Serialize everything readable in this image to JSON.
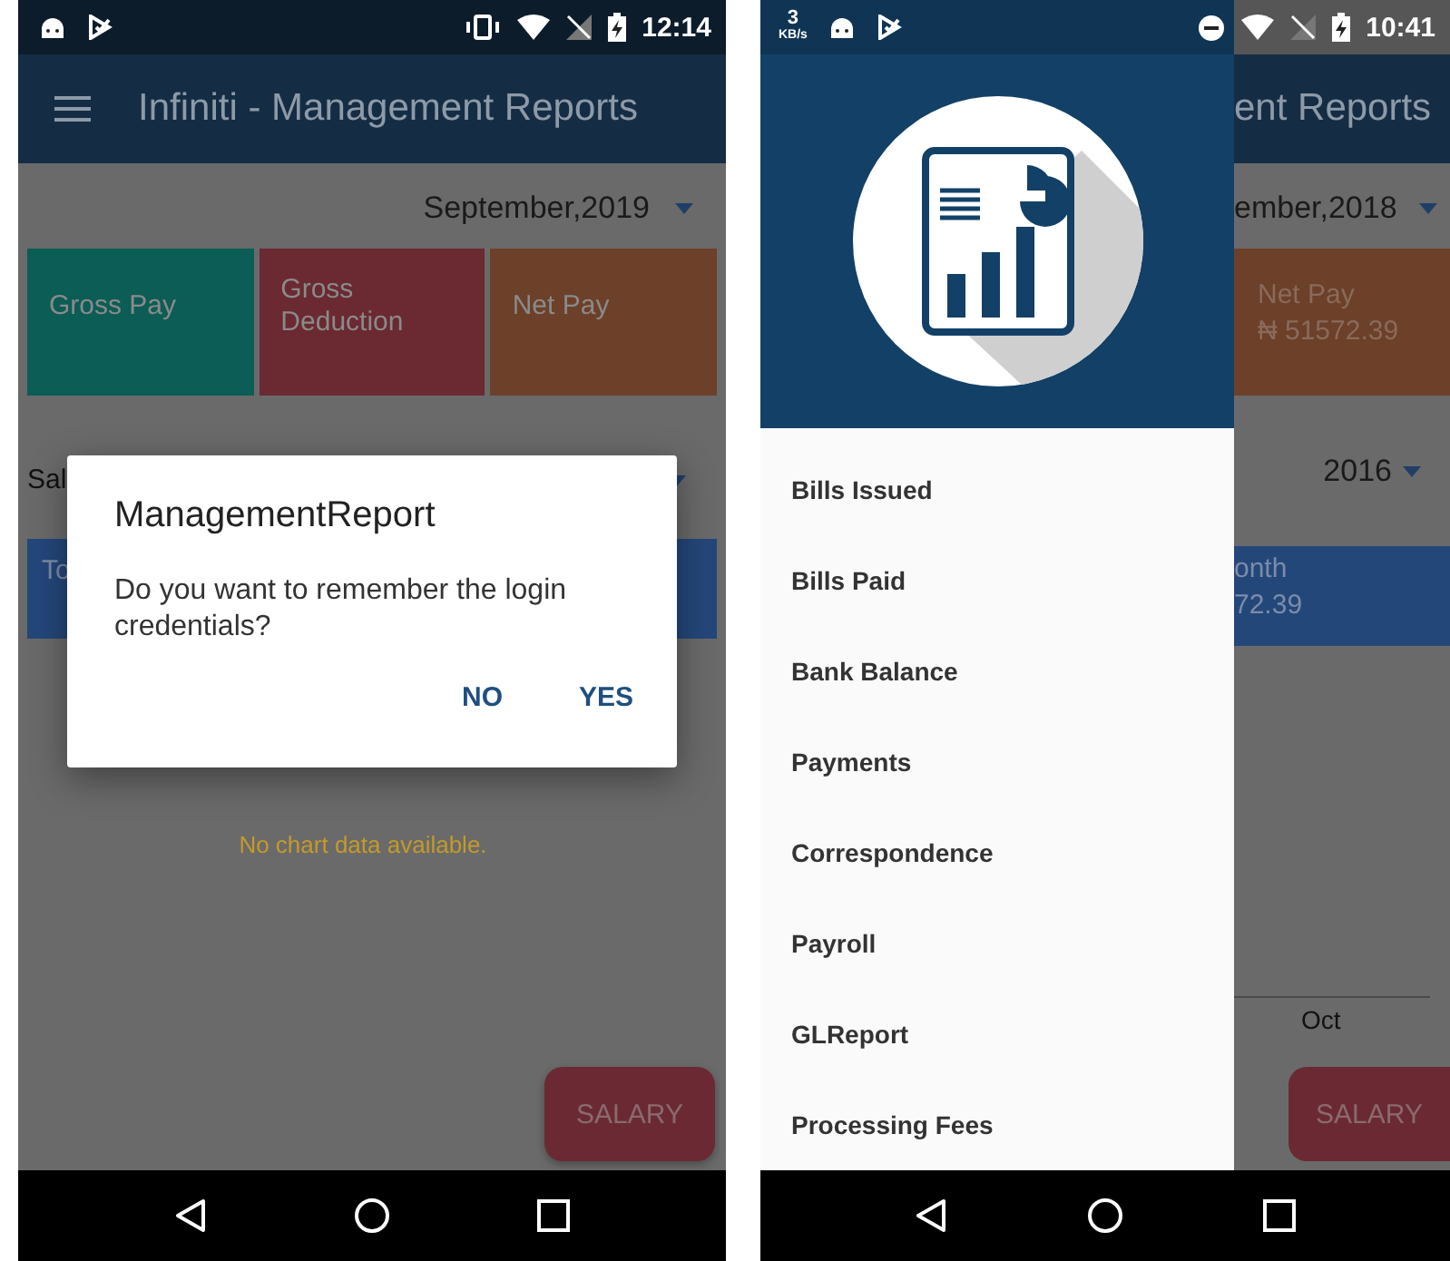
{
  "left_screen": {
    "status_bar": {
      "time": "12:14"
    },
    "app_bar": {
      "title": "Infiniti - Management Reports"
    },
    "period_dropdown": {
      "value": "September,2019"
    },
    "cards": [
      {
        "label": "Gross Pay",
        "color": "#0b5d55"
      },
      {
        "label": "Gross Deduction",
        "color": "#6b2932"
      },
      {
        "label": "Net Pay",
        "color": "#6c4029"
      }
    ],
    "report_selector": {
      "value": "Sal"
    },
    "total_bar": {
      "label": "To"
    },
    "chart_message": "No chart data available.",
    "fab": "SALARY",
    "dialog": {
      "title": "ManagementReport",
      "message": "Do you want to remember the login credentials?",
      "buttons": [
        "NO",
        "YES"
      ]
    }
  },
  "right_screen": {
    "status_bar": {
      "speed_value": "3",
      "speed_unit": "KB/s",
      "time": "10:41"
    },
    "drawer": {
      "items": [
        "Bills Issued",
        "Bills Paid",
        "Bank Balance",
        "Payments",
        "Correspondence",
        "Payroll",
        "GLReport",
        "Processing Fees"
      ]
    },
    "background": {
      "app_bar_title": "ent Reports",
      "period": "ember,2018",
      "card": {
        "label": "Net Pay",
        "amount": "₦ 51572.39",
        "color": "#6c4029"
      },
      "year": "2016",
      "total_bar": {
        "label": "onth",
        "amount": "72.39"
      },
      "axis_label": "Oct",
      "fab": "SALARY"
    }
  }
}
